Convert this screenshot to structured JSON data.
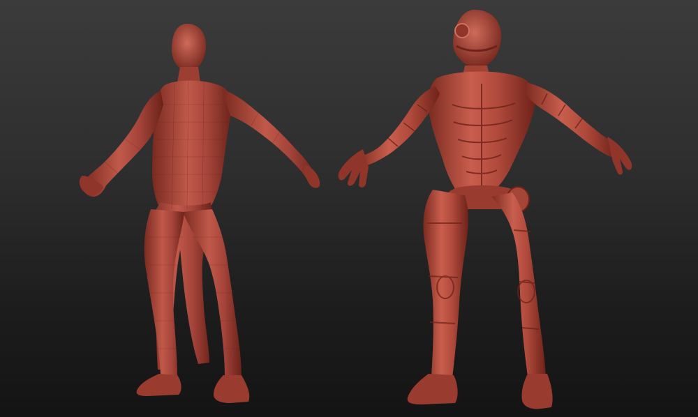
{
  "scene": {
    "background_top": "#3b3b3b",
    "background_bottom": "#141414",
    "clay_color": "#b04a3c",
    "clay_highlight": "#d0705e",
    "clay_shadow": "#6e2219",
    "models": [
      {
        "name": "base-mesh",
        "style": "wireframe-polygroups"
      },
      {
        "name": "armored-suit",
        "style": "sculpted-hard-surface"
      }
    ]
  }
}
